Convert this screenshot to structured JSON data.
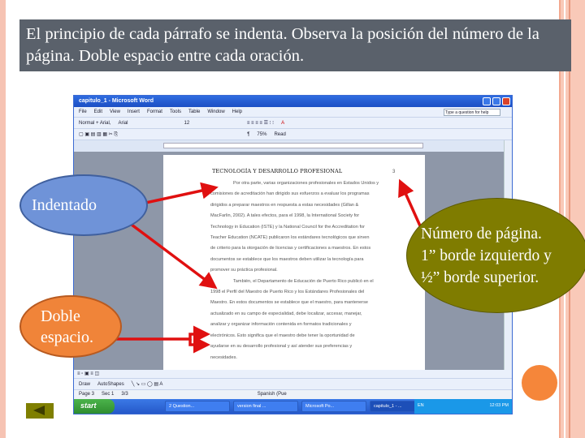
{
  "slide": {
    "title": "El principio de cada párrafo se indenta.  Observa la posición del número de la página.  Doble espacio entre cada oración."
  },
  "callouts": {
    "indent": "Indentado",
    "double_line1": "Doble",
    "double_line2": "espacio.",
    "page_line1": "Número de página.",
    "page_line2": "1” borde izquierdo y",
    "page_line3": "½” borde superior."
  },
  "word": {
    "window_title": "capitulo_1 - Microsoft Word",
    "menu": [
      "File",
      "Edit",
      "View",
      "Insert",
      "Format",
      "Tools",
      "Table",
      "Window",
      "Help"
    ],
    "help_placeholder": "Type a question for help",
    "style": "Normal + Arial,",
    "font": "Arial",
    "size": "12",
    "zoom": "75%",
    "read": "Read",
    "header": "TECNOLOGÍA Y DESARROLLO PROFESIONAL",
    "page_number": "3",
    "lines": [
      "Por otra parte, varias organizaciones profesionales en Estados Unidos y",
      "comisiones de acreditación han dirigido sus esfuerzos a evaluar los programas",
      "dirigidos a preparar maestros en respuesta a estas necesidades (Gillan &",
      "MacFarlin, 2002).  A tales efectos, para el 1998, la International Society for",
      "Technology in Education (ISTE) y la National Council for the Accreditation for",
      "Teacher Education (NCATE) publicaron los estándares tecnológicos que sirven",
      "de criterio para la otorgación de licencias y certificaciones a maestros.  En estos",
      "documentos se establece que los maestros deben utilizar la tecnología para",
      "promover su práctica profesional.",
      "También, el Departamento de Educación de Puerto Rico publicó en el",
      "1998 el Perfil del Maestro de Puerto Rico y los Estándares Profesionales del",
      "Maestro.  En estos documentos se establece que el maestro, para mantenerse",
      "actualizado en su campo de especialidad, debe localizar, accesar, manejar,",
      "analizar y organizar información contenida en formatos tradicionales y",
      "electrónicos.  Esto significa que el maestro debe tener la oportunidad de",
      "ayudarse en su desarrollo profesional y así atender sus preferencias y",
      "necesidades."
    ],
    "draw": "Draw",
    "autoshapes": "AutoShapes",
    "status": {
      "page": "Page 3",
      "sec": "Sec 1",
      "count": "3/3",
      "lang": "Spanish (Pue"
    },
    "taskbar": {
      "start": "start",
      "tasks": [
        "2 Question...",
        "version final ...",
        "Microsoft Po...",
        "capitulo_1 - ..."
      ],
      "lang": "EN",
      "clock": "12:03 PM"
    }
  },
  "colors": {
    "title_bg": "#5a616b",
    "indent_bubble": "#6f93d8",
    "double_bubble": "#f08439",
    "page_bubble": "#7f7c00",
    "arrow": "#e01010"
  }
}
